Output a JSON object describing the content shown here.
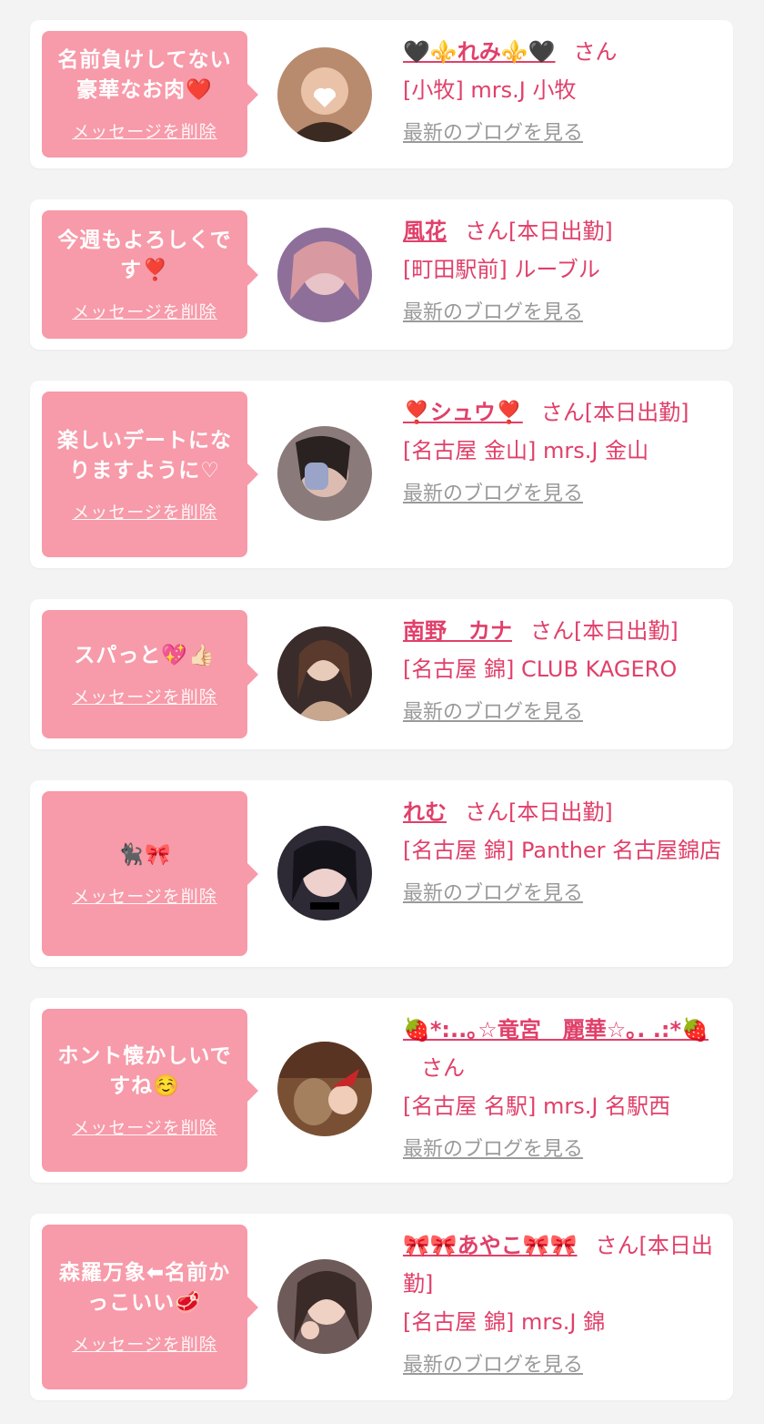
{
  "entries": [
    {
      "message": "名前負けしてない豪華なお肉❤️",
      "delete_label": "メッセージを削除",
      "name": "🖤⚜️れみ⚜️🖤",
      "suffix": "さん",
      "shop": "[小牧] mrs.J 小牧",
      "blog_label": "最新のブログを見る",
      "avatar_color": "#b88a6e"
    },
    {
      "message": "今週もよろしくです❣️",
      "delete_label": "メッセージを削除",
      "name": "風花",
      "suffix": "さん[本日出勤]",
      "shop": "[町田駅前] ルーブル",
      "blog_label": "最新のブログを見る",
      "avatar_color": "#8e6f9a"
    },
    {
      "message": "楽しいデートになりますように♡",
      "delete_label": "メッセージを削除",
      "name": "❣️シュウ❣️",
      "suffix": "さん[本日出勤]",
      "shop": "[名古屋 金山] mrs.J 金山",
      "blog_label": "最新のブログを見る",
      "avatar_color": "#8a7a7a"
    },
    {
      "message": "スパっと💖👍🏻",
      "delete_label": "メッセージを削除",
      "name": "南野　カナ",
      "suffix": "さん[本日出勤]",
      "shop": "[名古屋 錦] CLUB KAGERO",
      "blog_label": "最新のブログを見る",
      "avatar_color": "#3a2c2a"
    },
    {
      "message": "🐈‍⬛🎀",
      "delete_label": "メッセージを削除",
      "name": "れむ",
      "suffix": "さん[本日出勤]",
      "shop": "[名古屋 錦] Panther 名古屋錦店",
      "blog_label": "最新のブログを見る",
      "avatar_color": "#2e2a35"
    },
    {
      "message": "ホント懐かしいですね☺️",
      "delete_label": "メッセージを削除",
      "name": "🍓*:..｡☆竜宮　麗華☆｡. .:*🍓",
      "suffix": "さん",
      "shop": "[名古屋 名駅] mrs.J 名駅西",
      "blog_label": "最新のブログを見る",
      "avatar_color": "#7a5034"
    },
    {
      "message": "森羅万象⬅名前かっこいい🥩",
      "delete_label": "メッセージを削除",
      "name": "🎀🎀あやこ🎀🎀",
      "suffix": "さん[本日出勤]",
      "shop": "[名古屋 錦] mrs.J 錦",
      "blog_label": "最新のブログを見る",
      "avatar_color": "#6e5a58"
    }
  ]
}
